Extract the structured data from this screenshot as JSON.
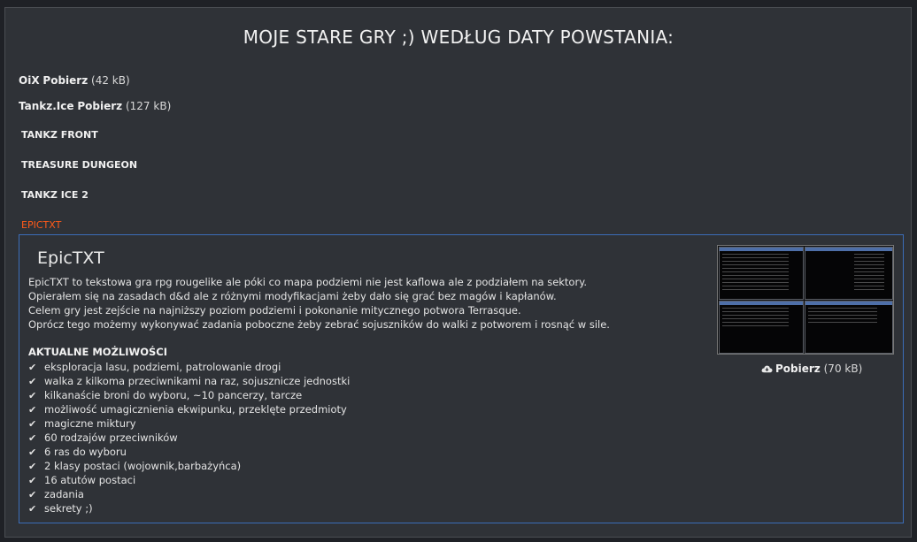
{
  "page": {
    "title": "MOJE STARE GRY ;) WEDŁUG DATY POWSTANIA:"
  },
  "downloads": [
    {
      "name": "OiX",
      "link": "Pobierz",
      "size": "(42 kB)"
    },
    {
      "name": "Tankz.Ice",
      "link": "Pobierz",
      "size": "(127 kB)"
    }
  ],
  "nav": [
    {
      "label": "TANKZ FRONT",
      "active": false
    },
    {
      "label": "TREASURE DUNGEON",
      "active": false
    },
    {
      "label": "TANKZ ICE 2",
      "active": false
    },
    {
      "label": "EPICTXT",
      "active": true
    }
  ],
  "game": {
    "title": "EpicTXT",
    "description": [
      "EpicTXT to tekstowa gra rpg rougelike ale póki co mapa podziemi nie jest kaflowa ale z podziałem na sektory.",
      "Opierałem się na zasadach d&d ale z różnymi modyfikacjami żeby dało się grać bez magów i kapłanów.",
      "Celem gry jest zejście na najniższy poziom podziemi i pokonanie mitycznego potwora Terrasque.",
      "Oprócz tego możemy wykonywać zadania poboczne żeby zebrać sojuszników do walki z potworem i rosnąć w sile."
    ],
    "features_heading": "AKTUALNE MOŻLIWOŚCI",
    "features": [
      "eksploracja lasu, podziemi, patrolowanie drogi",
      "walka z kilkoma przeciwnikami na raz, sojusznicze jednostki",
      "kilkanaście broni do wyboru, ~10 pancerzy, tarcze",
      "możliwość umagicznienia ekwipunku, przeklęte przedmioty",
      "magiczne miktury",
      "60 rodzajów przeciwników",
      "6 ras do wyboru",
      "2 klasy postaci (wojownik,barbażyńca)",
      "16 atutów postaci",
      "zadania",
      "sekrety ;)"
    ],
    "download_link": "Pobierz",
    "download_size": "(70 kB)"
  },
  "colors": {
    "background": "#2f3237",
    "panel_border": "#3b6db8",
    "active_nav": "#ff5a1a"
  },
  "icons": {
    "feature_bullet": "check-icon",
    "download": "cloud-download-icon"
  }
}
